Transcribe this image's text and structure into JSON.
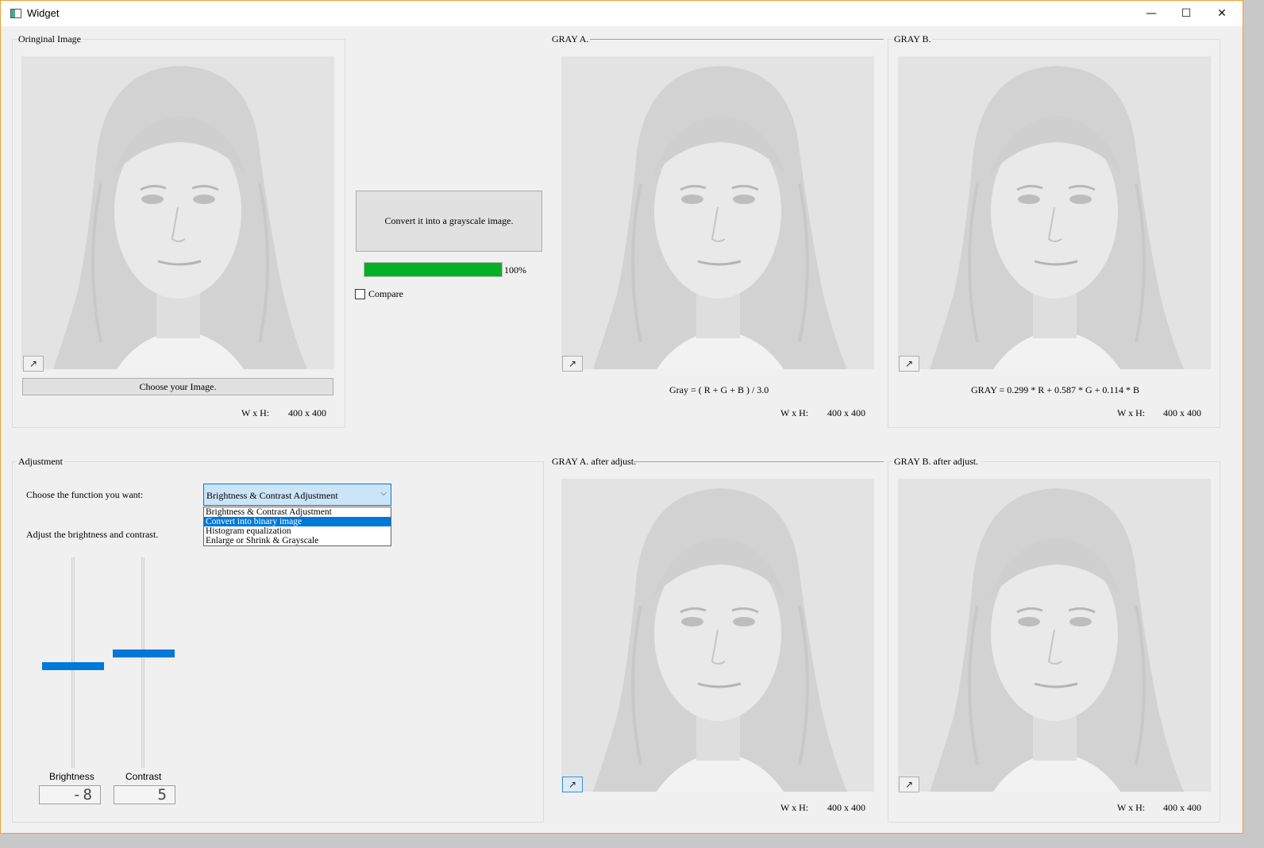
{
  "window": {
    "title": "Widget",
    "minimize": "—",
    "maximize": "☐",
    "close": "✕"
  },
  "original": {
    "title": "Oringinal Image",
    "expand_icon": "↗",
    "choose_button": "Choose your Image.",
    "wh_label": "W x H:",
    "wh_value": "400 x 400"
  },
  "convert": {
    "button": "Convert it into a grayscale image.",
    "progress_percent": 100,
    "progress_text": "100%",
    "compare_label": "Compare",
    "compare_checked": false
  },
  "gray_a": {
    "title": "GRAY A.",
    "formula": "Gray = ( R + G + B ) / 3.0",
    "wh_label": "W x H:",
    "wh_value": "400 x 400"
  },
  "gray_b": {
    "title": "GRAY B.",
    "formula": "GRAY = 0.299 * R + 0.587 * G + 0.114 * B",
    "wh_label": "W x H:",
    "wh_value": "400 x 400"
  },
  "adjustment": {
    "title": "Adjustment",
    "choose_label": "Choose the function you want:",
    "combo_value": "Brightness & Contrast Adjustment",
    "options": [
      "Brightness & Contrast Adjustment",
      "Convert into binary image",
      "Histogram equalization",
      "Enlarge or Shrink & Grayscale"
    ],
    "selected_option_index": 1,
    "adjust_label": "Adjust the brightness and contrast.",
    "brightness_label": "Brightness",
    "brightness_value": "-8",
    "contrast_label": "Contrast",
    "contrast_value": "5"
  },
  "gray_a_adj": {
    "title": "GRAY A. after adjust.",
    "wh_label": "W x H:",
    "wh_value": "400 x 400"
  },
  "gray_b_adj": {
    "title": "GRAY B. after adjust.",
    "wh_label": "W x H:",
    "wh_value": "400 x 400"
  },
  "colors": {
    "accent": "#0078d7",
    "progress": "#06b025",
    "window_border": "#e8a23a"
  }
}
